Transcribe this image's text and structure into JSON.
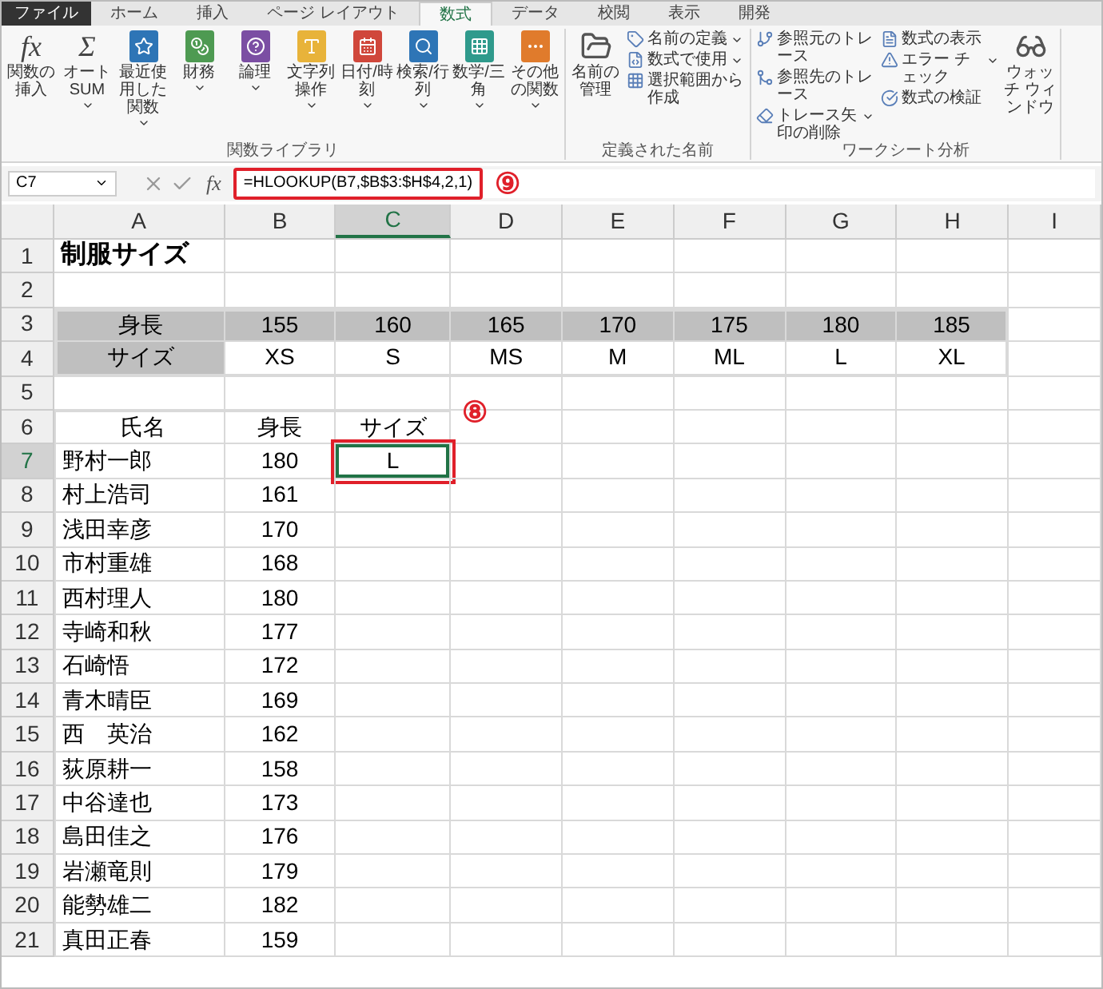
{
  "tabs": [
    {
      "label": "ファイル",
      "kind": "file",
      "selected": false
    },
    {
      "label": "ホーム",
      "kind": "tab",
      "selected": false
    },
    {
      "label": "挿入",
      "kind": "tab",
      "selected": false
    },
    {
      "label": "ページ レイアウト",
      "kind": "tab",
      "selected": false
    },
    {
      "label": "数式",
      "kind": "tab",
      "selected": true
    },
    {
      "label": "データ",
      "kind": "tab",
      "selected": false
    },
    {
      "label": "校閲",
      "kind": "tab",
      "selected": false
    },
    {
      "label": "表示",
      "kind": "tab",
      "selected": false
    },
    {
      "label": "開発",
      "kind": "tab",
      "selected": false
    }
  ],
  "ribbon": {
    "groups": [
      {
        "label": "関数ライブラリ",
        "items": [
          {
            "kind": "large",
            "glyph": "fx",
            "label": "関数の挿入",
            "dropdown": false
          },
          {
            "kind": "large",
            "glyph": "Σ",
            "label": "オート SUM",
            "dropdown": true
          },
          {
            "kind": "large",
            "label": "最近使用した関数",
            "dropdown": true
          },
          {
            "kind": "large",
            "label": "財務",
            "dropdown": true
          },
          {
            "kind": "large",
            "label": "論理",
            "dropdown": true
          },
          {
            "kind": "large",
            "label": "文字列操作",
            "dropdown": true
          },
          {
            "kind": "large",
            "label": "日付/時刻",
            "dropdown": true
          },
          {
            "kind": "large",
            "label": "検索/行列",
            "dropdown": true
          },
          {
            "kind": "large",
            "label": "数学/三角",
            "dropdown": true
          },
          {
            "kind": "large",
            "label": "その他の関数",
            "dropdown": true
          }
        ]
      },
      {
        "label": "定義された名前",
        "items": [
          {
            "kind": "large",
            "label": "名前の管理",
            "dropdown": false
          },
          {
            "kind": "small",
            "label": "名前の定義",
            "dropdown": true
          },
          {
            "kind": "small",
            "label": "数式で使用",
            "dropdown": true
          },
          {
            "kind": "small",
            "label": "選択範囲から作成",
            "dropdown": false
          }
        ]
      },
      {
        "label": "ワークシート分析",
        "items": [
          {
            "kind": "small",
            "label": "参照元のトレース",
            "dropdown": false
          },
          {
            "kind": "small",
            "label": "参照先のトレース",
            "dropdown": false
          },
          {
            "kind": "small",
            "label": "トレース矢印の削除",
            "dropdown": true
          },
          {
            "kind": "small",
            "label": "数式の表示",
            "dropdown": false
          },
          {
            "kind": "small",
            "label": "エラー チェック",
            "dropdown": true
          },
          {
            "kind": "small",
            "label": "数式の検証",
            "dropdown": false
          },
          {
            "kind": "large",
            "label": "ウォッチ ウィンドウ",
            "dropdown": false
          }
        ]
      }
    ]
  },
  "formula_bar": {
    "name_box": "C7",
    "function_label": "fx",
    "formula": "=HLOOKUP(B7,$B$3:$H$4,2,1)",
    "callout": "⑨"
  },
  "sheet": {
    "columns": [
      {
        "label": "A",
        "selected": false
      },
      {
        "label": "B",
        "selected": false
      },
      {
        "label": "C",
        "selected": true
      },
      {
        "label": "D",
        "selected": false
      },
      {
        "label": "E",
        "selected": false
      },
      {
        "label": "F",
        "selected": false
      },
      {
        "label": "G",
        "selected": false
      },
      {
        "label": "H",
        "selected": false
      },
      {
        "label": "I",
        "selected": false
      }
    ],
    "rows": [
      {
        "header": "1",
        "kind": "title",
        "selected": false,
        "cells": [
          "制服サイズ"
        ]
      },
      {
        "header": "2",
        "kind": "blank",
        "selected": false,
        "cells": []
      },
      {
        "header": "3",
        "kind": "lookup_heading",
        "selected": false,
        "cells": [
          "身長",
          "155",
          "160",
          "165",
          "170",
          "175",
          "180",
          "185"
        ]
      },
      {
        "header": "4",
        "kind": "lookup_values",
        "selected": false,
        "cells": [
          "サイズ",
          "XS",
          "S",
          "MS",
          "M",
          "ML",
          "L",
          "XL"
        ]
      },
      {
        "header": "5",
        "kind": "blank",
        "selected": false,
        "cells": []
      },
      {
        "header": "6",
        "kind": "list_heading",
        "selected": false,
        "cells": [
          "氏名",
          "身長",
          "サイズ"
        ],
        "callout": "⑧"
      },
      {
        "header": "7",
        "kind": "list",
        "selected": true,
        "cells": [
          "野村一郎",
          "180",
          "L"
        ]
      },
      {
        "header": "8",
        "kind": "list",
        "selected": false,
        "cells": [
          "村上浩司",
          "161"
        ]
      },
      {
        "header": "9",
        "kind": "list",
        "selected": false,
        "cells": [
          "浅田幸彦",
          "170"
        ]
      },
      {
        "header": "10",
        "kind": "list",
        "selected": false,
        "cells": [
          "市村重雄",
          "168"
        ]
      },
      {
        "header": "11",
        "kind": "list",
        "selected": false,
        "cells": [
          "西村理人",
          "180"
        ]
      },
      {
        "header": "12",
        "kind": "list",
        "selected": false,
        "cells": [
          "寺崎和秋",
          "177"
        ]
      },
      {
        "header": "13",
        "kind": "list",
        "selected": false,
        "cells": [
          "石崎悟",
          "172"
        ]
      },
      {
        "header": "14",
        "kind": "list",
        "selected": false,
        "cells": [
          "青木晴臣",
          "169"
        ]
      },
      {
        "header": "15",
        "kind": "list",
        "selected": false,
        "cells": [
          "西　英治",
          "162"
        ]
      },
      {
        "header": "16",
        "kind": "list",
        "selected": false,
        "cells": [
          "荻原耕一",
          "158"
        ]
      },
      {
        "header": "17",
        "kind": "list",
        "selected": false,
        "cells": [
          "中谷達也",
          "173"
        ]
      },
      {
        "header": "18",
        "kind": "list",
        "selected": false,
        "cells": [
          "島田佳之",
          "176"
        ]
      },
      {
        "header": "19",
        "kind": "list",
        "selected": false,
        "cells": [
          "岩瀬竜則",
          "179"
        ]
      },
      {
        "header": "20",
        "kind": "list",
        "selected": false,
        "cells": [
          "能勢雄二",
          "182"
        ]
      },
      {
        "header": "21",
        "kind": "list",
        "selected": false,
        "cells": [
          "真田正春",
          "159"
        ]
      }
    ]
  }
}
